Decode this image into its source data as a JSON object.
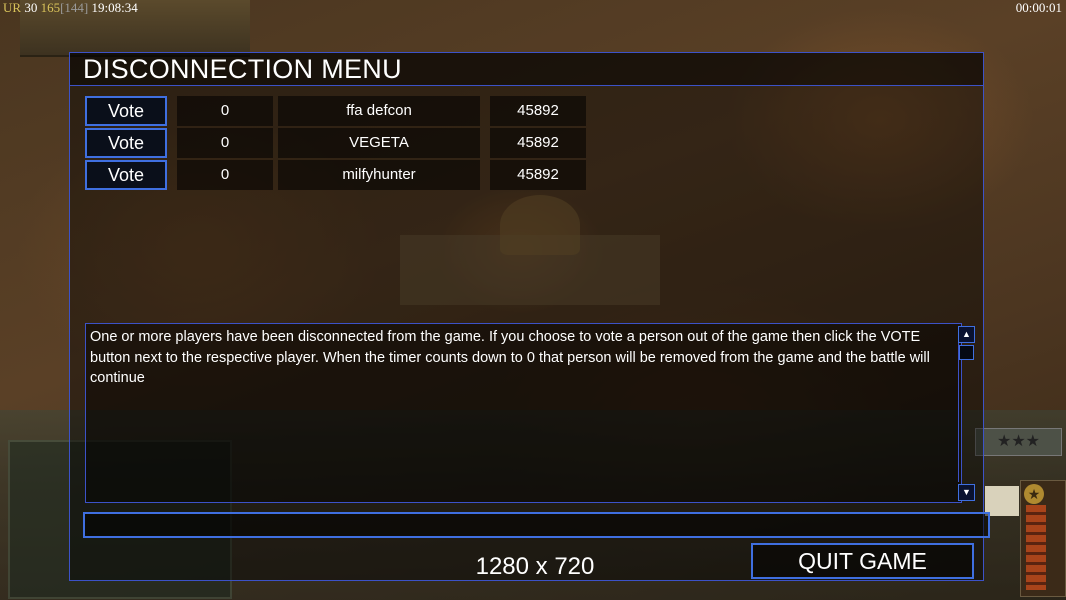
{
  "status_bar": {
    "left_tag": "UR",
    "value_a": "30",
    "value_b": "165",
    "value_c": "[144]",
    "clock": "19:08:34",
    "timer": "00:00:01"
  },
  "dialog": {
    "title": "DISCONNECTION MENU",
    "players": [
      {
        "vote_label": "Vote",
        "votes": "0",
        "name": "ffa defcon",
        "timeout": "45892"
      },
      {
        "vote_label": "Vote",
        "votes": "0",
        "name": "VEGETA",
        "timeout": "45892"
      },
      {
        "vote_label": "Vote",
        "votes": "0",
        "name": "milfyhunter",
        "timeout": "45892"
      }
    ],
    "message": "One or more players have been disconnected from the game. If you choose to vote a person out of the game then click the VOTE button next to the respective player. When the timer counts down to 0 that person will be removed from the game and the battle will continue",
    "chat_value": "",
    "resolution": "1280 x 720",
    "quit_label": "QUIT GAME"
  },
  "hud": {
    "rank_icon": "three-stars-icon",
    "general_icon": "star-emblem-icon"
  },
  "colors": {
    "accent_border": "#3f6fe0",
    "text": "#ffffff",
    "status_tag": "#d8c25a"
  }
}
